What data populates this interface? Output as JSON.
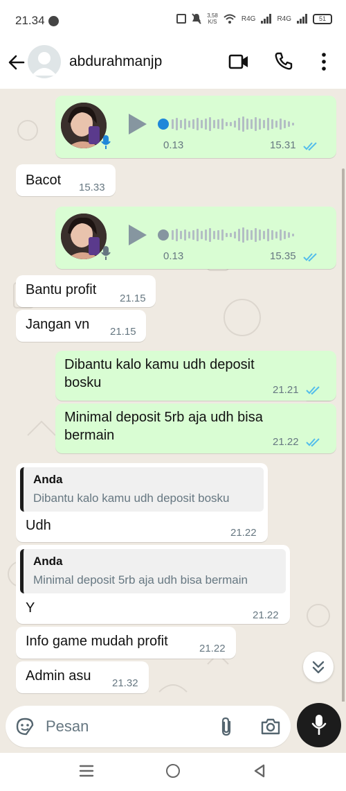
{
  "status_bar": {
    "time": "21.34",
    "network_speed_value": "3,58",
    "network_speed_unit": "K/S",
    "sim1": "R4G",
    "sim2": "R4G",
    "battery": "51"
  },
  "header": {
    "contact_name": "abdurahmanjp",
    "icons": [
      "back-arrow-icon",
      "avatar",
      "video-call-icon",
      "phone-call-icon",
      "more-vert-icon"
    ]
  },
  "messages": [
    {
      "type": "voice",
      "direction": "outgoing",
      "duration": "0.13",
      "time": "15.31",
      "read": true,
      "progress": 0.0
    },
    {
      "type": "text",
      "direction": "incoming",
      "text": "Bacot",
      "time": "15.33"
    },
    {
      "type": "voice",
      "direction": "outgoing",
      "duration": "0.13",
      "time": "15.35",
      "read": true,
      "progress": 0.0
    },
    {
      "type": "text",
      "direction": "incoming",
      "text": "Bantu profit",
      "time": "21.15"
    },
    {
      "type": "text",
      "direction": "incoming",
      "text": "Jangan vn",
      "time": "21.15"
    },
    {
      "type": "text",
      "direction": "outgoing",
      "text_line1": "Dibantu kalo kamu udh deposit",
      "text_line2": "bosku",
      "time": "21.21",
      "read": true
    },
    {
      "type": "text",
      "direction": "outgoing",
      "text_line1": "Minimal deposit 5rb aja udh bisa",
      "text_line2": "bermain",
      "time": "21.22",
      "read": true
    },
    {
      "type": "reply",
      "direction": "incoming",
      "quote_author": "Anda",
      "quote_text": "Dibantu kalo kamu udh deposit bosku",
      "text": "Udh",
      "time": "21.22"
    },
    {
      "type": "reply",
      "direction": "incoming",
      "quote_author": "Anda",
      "quote_text": "Minimal deposit 5rb aja udh bisa bermain",
      "text": "Y",
      "time": "21.22"
    },
    {
      "type": "text",
      "direction": "incoming",
      "text": "Info game mudah profit",
      "time": "21.22"
    },
    {
      "type": "text",
      "direction": "incoming",
      "text": "Admin asu",
      "time": "21.32"
    }
  ],
  "composer": {
    "placeholder": "Pesan",
    "icons": [
      "sticker-icon",
      "attach-icon",
      "camera-icon",
      "mic-icon"
    ]
  },
  "colors": {
    "chat_bg": "#efeae2",
    "outgoing_bubble": "#d9fdd3",
    "incoming_bubble": "#ffffff",
    "read_tick": "#53bdeb",
    "voice_active_dot": "#1f87d9",
    "mic_button": "#1c1c1c"
  }
}
